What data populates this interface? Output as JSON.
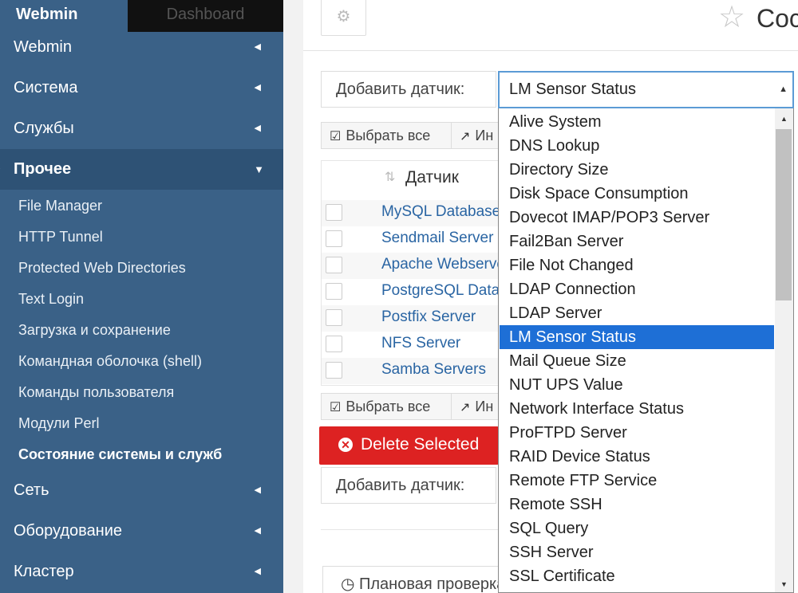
{
  "sidebar": {
    "tabs": {
      "webmin": "Webmin",
      "dashboard": "Dashboard"
    },
    "categories": [
      {
        "label": "Webmin"
      },
      {
        "label": "Система"
      },
      {
        "label": "Службы"
      },
      {
        "label": "Прочее"
      },
      {
        "label": "Сеть"
      },
      {
        "label": "Оборудование"
      },
      {
        "label": "Кластер"
      }
    ],
    "other_items": [
      {
        "label": "File Manager"
      },
      {
        "label": "HTTP Tunnel"
      },
      {
        "label": "Protected Web Directories"
      },
      {
        "label": "Text Login"
      },
      {
        "label": "Загрузка и сохранение"
      },
      {
        "label": "Командная оболочка (shell)"
      },
      {
        "label": "Команды пользователя"
      },
      {
        "label": "Модули Perl"
      },
      {
        "label": "Состояние системы и служб"
      }
    ]
  },
  "header": {
    "title": "Coc"
  },
  "add_sensor": {
    "label": "Добавить датчик:",
    "selected": "LM Sensor Status"
  },
  "buttons": {
    "select_all": "Выбрать все",
    "invert": "Ин",
    "delete_selected": "Delete Selected"
  },
  "table": {
    "header": "Датчик",
    "rows": [
      {
        "name": "MySQL Database Server"
      },
      {
        "name": "Sendmail Server"
      },
      {
        "name": "Apache Webserver"
      },
      {
        "name": "PostgreSQL Database Server"
      },
      {
        "name": "Postfix Server"
      },
      {
        "name": "NFS Server"
      },
      {
        "name": "Samba Servers"
      }
    ]
  },
  "scheduled": {
    "label": "Плановая проверка"
  },
  "dropdown": {
    "options": [
      "Alive System",
      "DNS Lookup",
      "Directory Size",
      "Disk Space Consumption",
      "Dovecot IMAP/POP3 Server",
      "Fail2Ban Server",
      "File Not Changed",
      "LDAP Connection",
      "LDAP Server",
      "LM Sensor Status",
      "Mail Queue Size",
      "NUT UPS Value",
      "Network Interface Status",
      "ProFTPD Server",
      "RAID Device Status",
      "Remote FTP Service",
      "Remote SSH",
      "SQL Query",
      "SSH Server",
      "SSL Certificate"
    ]
  },
  "icons": {
    "gear": "gear-icon",
    "star": "star-icon",
    "checkbox": "check-square-icon",
    "invert": "share-icon",
    "delete": "times-circle-icon",
    "clock": "clock-icon",
    "caret_left": "caret-left-icon",
    "caret_down": "caret-down-icon"
  },
  "colors": {
    "sidebar_bg": "#3a6187",
    "sidebar_active": "#2e5275",
    "delete_red": "#dd2222",
    "selection_blue": "#1e6fd6",
    "link_blue": "#2a65a3"
  }
}
